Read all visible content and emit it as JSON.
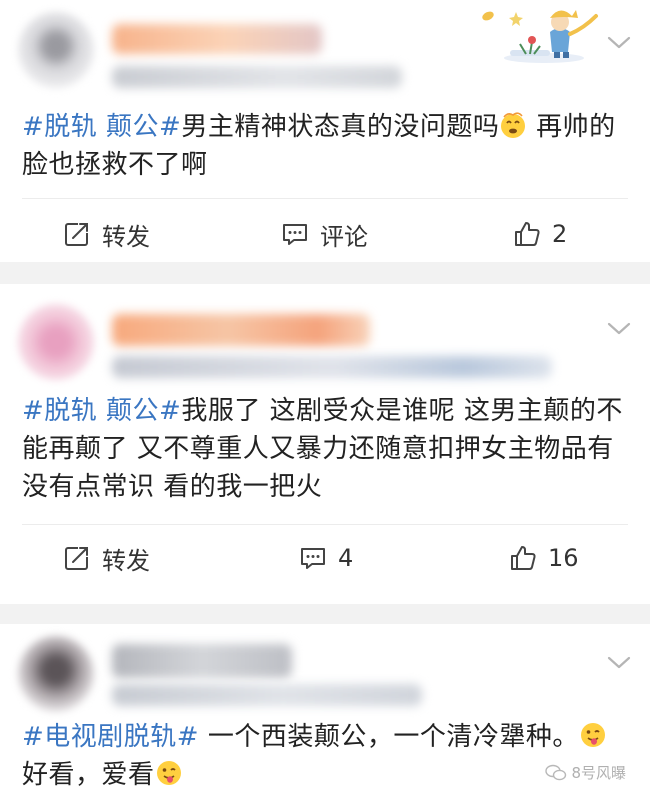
{
  "posts": [
    {
      "hashtag": "#脱轨 颠公#",
      "text_before_emoji": "男主精神状态真的没问题吗",
      "emoji": "dizzy-face-emoji",
      "text_after_emoji": " 再帅的脸也拯救不了啊",
      "actions": {
        "repost_label": "转发",
        "comment_label": "评论",
        "like_count": "2"
      }
    },
    {
      "hashtag": "#脱轨 颠公#",
      "text": "我服了 这剧受众是谁呢 这男主颠的不能再颠了 又不尊重人又暴力还随意扣押女主物品有没有点常识 看的我一把火",
      "actions": {
        "repost_label": "转发",
        "comment_count": "4",
        "like_count": "16"
      }
    },
    {
      "hashtag": "#电视剧脱轨#",
      "text_line1": " 一个西装颠公，一个清冷犟种。",
      "emoji1": "tongue-face-emoji",
      "text_line2": "好看，爱看",
      "emoji2": "tongue-face-emoji"
    }
  ],
  "watermark": {
    "text": "8号风曝"
  },
  "colors": {
    "hashtag": "#3a76c2",
    "text": "#222222",
    "background": "#f2f2f2",
    "card": "#ffffff",
    "icon": "#444444"
  }
}
